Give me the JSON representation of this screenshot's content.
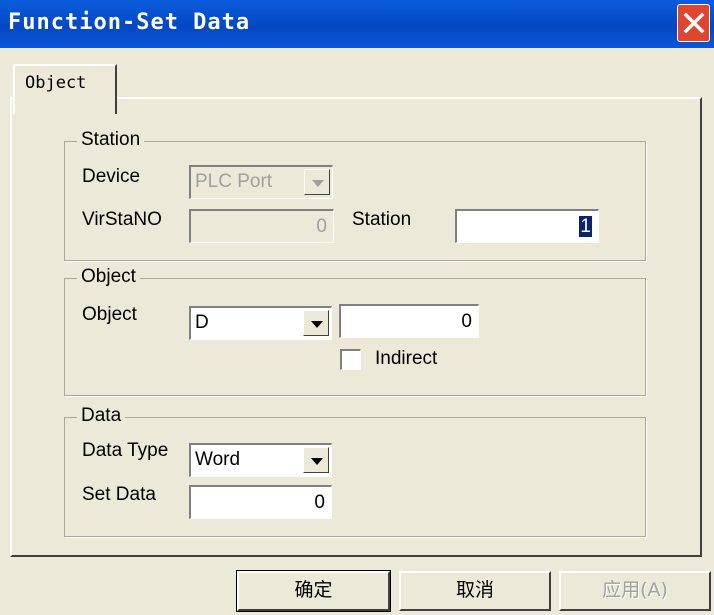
{
  "window": {
    "title": "Function-Set Data"
  },
  "tabs": [
    {
      "label": "Object"
    }
  ],
  "station_group": {
    "legend": "Station",
    "device_label": "Device",
    "device_value": "PLC Port",
    "virstano_label": "VirStaNO",
    "virstano_value": "0",
    "station_label": "Station",
    "station_value": "1"
  },
  "object_group": {
    "legend": "Object",
    "object_label": "Object",
    "object_type_value": "D",
    "object_address_value": "0",
    "indirect_label": "Indirect",
    "indirect_checked": false
  },
  "data_group": {
    "legend": "Data",
    "data_type_label": "Data Type",
    "data_type_value": "Word",
    "set_data_label": "Set Data",
    "set_data_value": "0"
  },
  "buttons": {
    "ok": "确定",
    "cancel": "取消",
    "apply": "应用(A)"
  }
}
